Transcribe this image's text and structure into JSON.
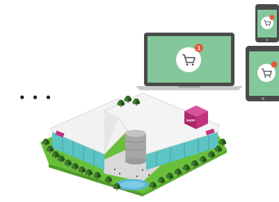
{
  "scene": {
    "ellipsis": "• • •",
    "badge_count": "1",
    "sign_text": "SHOP",
    "colors": {
      "screen_green": "#84c79a",
      "device_frame": "#4a4a4a",
      "badge_red": "#e05a3a",
      "sign_magenta": "#c2347f",
      "grass": "#6abf3a",
      "tree": "#2f6a25",
      "glass": "#5cc4c2",
      "roof": "#f2f2f2",
      "water": "#5bb7d8"
    },
    "icons": [
      "laptop-icon",
      "phone-icon",
      "tablet-icon",
      "shopping-cart-icon",
      "notification-badge-icon",
      "shopping-mall-icon"
    ]
  }
}
